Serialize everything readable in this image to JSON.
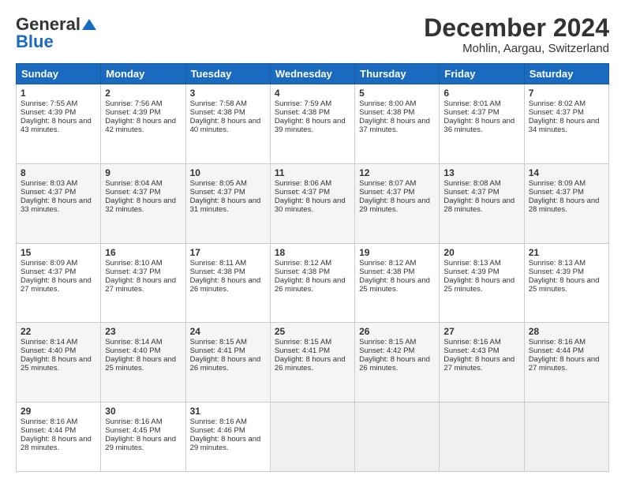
{
  "logo": {
    "general": "General",
    "blue": "Blue"
  },
  "header": {
    "title": "December 2024",
    "subtitle": "Mohlin, Aargau, Switzerland"
  },
  "days": [
    "Sunday",
    "Monday",
    "Tuesday",
    "Wednesday",
    "Thursday",
    "Friday",
    "Saturday"
  ],
  "weeks": [
    [
      {
        "day": "1",
        "sunrise": "Sunrise: 7:55 AM",
        "sunset": "Sunset: 4:39 PM",
        "daylight": "Daylight: 8 hours and 43 minutes."
      },
      {
        "day": "2",
        "sunrise": "Sunrise: 7:56 AM",
        "sunset": "Sunset: 4:39 PM",
        "daylight": "Daylight: 8 hours and 42 minutes."
      },
      {
        "day": "3",
        "sunrise": "Sunrise: 7:58 AM",
        "sunset": "Sunset: 4:38 PM",
        "daylight": "Daylight: 8 hours and 40 minutes."
      },
      {
        "day": "4",
        "sunrise": "Sunrise: 7:59 AM",
        "sunset": "Sunset: 4:38 PM",
        "daylight": "Daylight: 8 hours and 39 minutes."
      },
      {
        "day": "5",
        "sunrise": "Sunrise: 8:00 AM",
        "sunset": "Sunset: 4:38 PM",
        "daylight": "Daylight: 8 hours and 37 minutes."
      },
      {
        "day": "6",
        "sunrise": "Sunrise: 8:01 AM",
        "sunset": "Sunset: 4:37 PM",
        "daylight": "Daylight: 8 hours and 36 minutes."
      },
      {
        "day": "7",
        "sunrise": "Sunrise: 8:02 AM",
        "sunset": "Sunset: 4:37 PM",
        "daylight": "Daylight: 8 hours and 34 minutes."
      }
    ],
    [
      {
        "day": "8",
        "sunrise": "Sunrise: 8:03 AM",
        "sunset": "Sunset: 4:37 PM",
        "daylight": "Daylight: 8 hours and 33 minutes."
      },
      {
        "day": "9",
        "sunrise": "Sunrise: 8:04 AM",
        "sunset": "Sunset: 4:37 PM",
        "daylight": "Daylight: 8 hours and 32 minutes."
      },
      {
        "day": "10",
        "sunrise": "Sunrise: 8:05 AM",
        "sunset": "Sunset: 4:37 PM",
        "daylight": "Daylight: 8 hours and 31 minutes."
      },
      {
        "day": "11",
        "sunrise": "Sunrise: 8:06 AM",
        "sunset": "Sunset: 4:37 PM",
        "daylight": "Daylight: 8 hours and 30 minutes."
      },
      {
        "day": "12",
        "sunrise": "Sunrise: 8:07 AM",
        "sunset": "Sunset: 4:37 PM",
        "daylight": "Daylight: 8 hours and 29 minutes."
      },
      {
        "day": "13",
        "sunrise": "Sunrise: 8:08 AM",
        "sunset": "Sunset: 4:37 PM",
        "daylight": "Daylight: 8 hours and 28 minutes."
      },
      {
        "day": "14",
        "sunrise": "Sunrise: 8:09 AM",
        "sunset": "Sunset: 4:37 PM",
        "daylight": "Daylight: 8 hours and 28 minutes."
      }
    ],
    [
      {
        "day": "15",
        "sunrise": "Sunrise: 8:09 AM",
        "sunset": "Sunset: 4:37 PM",
        "daylight": "Daylight: 8 hours and 27 minutes."
      },
      {
        "day": "16",
        "sunrise": "Sunrise: 8:10 AM",
        "sunset": "Sunset: 4:37 PM",
        "daylight": "Daylight: 8 hours and 27 minutes."
      },
      {
        "day": "17",
        "sunrise": "Sunrise: 8:11 AM",
        "sunset": "Sunset: 4:38 PM",
        "daylight": "Daylight: 8 hours and 26 minutes."
      },
      {
        "day": "18",
        "sunrise": "Sunrise: 8:12 AM",
        "sunset": "Sunset: 4:38 PM",
        "daylight": "Daylight: 8 hours and 26 minutes."
      },
      {
        "day": "19",
        "sunrise": "Sunrise: 8:12 AM",
        "sunset": "Sunset: 4:38 PM",
        "daylight": "Daylight: 8 hours and 25 minutes."
      },
      {
        "day": "20",
        "sunrise": "Sunrise: 8:13 AM",
        "sunset": "Sunset: 4:39 PM",
        "daylight": "Daylight: 8 hours and 25 minutes."
      },
      {
        "day": "21",
        "sunrise": "Sunrise: 8:13 AM",
        "sunset": "Sunset: 4:39 PM",
        "daylight": "Daylight: 8 hours and 25 minutes."
      }
    ],
    [
      {
        "day": "22",
        "sunrise": "Sunrise: 8:14 AM",
        "sunset": "Sunset: 4:40 PM",
        "daylight": "Daylight: 8 hours and 25 minutes."
      },
      {
        "day": "23",
        "sunrise": "Sunrise: 8:14 AM",
        "sunset": "Sunset: 4:40 PM",
        "daylight": "Daylight: 8 hours and 25 minutes."
      },
      {
        "day": "24",
        "sunrise": "Sunrise: 8:15 AM",
        "sunset": "Sunset: 4:41 PM",
        "daylight": "Daylight: 8 hours and 26 minutes."
      },
      {
        "day": "25",
        "sunrise": "Sunrise: 8:15 AM",
        "sunset": "Sunset: 4:41 PM",
        "daylight": "Daylight: 8 hours and 26 minutes."
      },
      {
        "day": "26",
        "sunrise": "Sunrise: 8:15 AM",
        "sunset": "Sunset: 4:42 PM",
        "daylight": "Daylight: 8 hours and 26 minutes."
      },
      {
        "day": "27",
        "sunrise": "Sunrise: 8:16 AM",
        "sunset": "Sunset: 4:43 PM",
        "daylight": "Daylight: 8 hours and 27 minutes."
      },
      {
        "day": "28",
        "sunrise": "Sunrise: 8:16 AM",
        "sunset": "Sunset: 4:44 PM",
        "daylight": "Daylight: 8 hours and 27 minutes."
      }
    ],
    [
      {
        "day": "29",
        "sunrise": "Sunrise: 8:16 AM",
        "sunset": "Sunset: 4:44 PM",
        "daylight": "Daylight: 8 hours and 28 minutes."
      },
      {
        "day": "30",
        "sunrise": "Sunrise: 8:16 AM",
        "sunset": "Sunset: 4:45 PM",
        "daylight": "Daylight: 8 hours and 29 minutes."
      },
      {
        "day": "31",
        "sunrise": "Sunrise: 8:16 AM",
        "sunset": "Sunset: 4:46 PM",
        "daylight": "Daylight: 8 hours and 29 minutes."
      },
      null,
      null,
      null,
      null
    ]
  ]
}
